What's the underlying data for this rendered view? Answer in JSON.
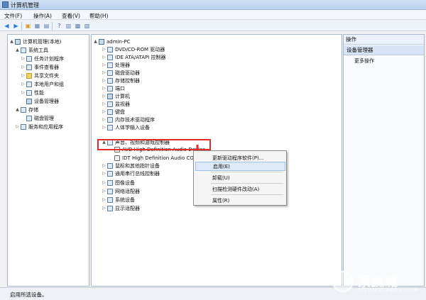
{
  "window": {
    "title": "计算机管理"
  },
  "menu": [
    "文件(F)",
    "操作(A)",
    "查看(V)",
    "帮助(H)"
  ],
  "left_tree": [
    {
      "label": "计算机管理(本地)",
      "indent": 0,
      "expander": "▲"
    },
    {
      "label": "系统工具",
      "indent": 1,
      "expander": "▲"
    },
    {
      "label": "任务计划程序",
      "indent": 2,
      "expander": "▷"
    },
    {
      "label": "事件查看器",
      "indent": 2,
      "expander": "▷"
    },
    {
      "label": "共享文件夹",
      "indent": 2,
      "expander": "▷"
    },
    {
      "label": "本地用户和组",
      "indent": 2,
      "expander": "▷"
    },
    {
      "label": "性能",
      "indent": 2,
      "expander": "▷"
    },
    {
      "label": "设备管理器",
      "indent": 2,
      "expander": ""
    },
    {
      "label": "存储",
      "indent": 1,
      "expander": "▲"
    },
    {
      "label": "磁盘管理",
      "indent": 2,
      "expander": ""
    },
    {
      "label": "服务和应用程序",
      "indent": 1,
      "expander": "▷"
    }
  ],
  "device_tree": [
    {
      "label": "admin-PC",
      "indent": 0,
      "expander": "▲"
    },
    {
      "label": "DVD/CD-ROM 驱动器",
      "indent": 1,
      "expander": "▷"
    },
    {
      "label": "IDE ATA/ATAPI 控制器",
      "indent": 1,
      "expander": "▷"
    },
    {
      "label": "处理器",
      "indent": 1,
      "expander": "▷"
    },
    {
      "label": "磁盘驱动器",
      "indent": 1,
      "expander": "▷"
    },
    {
      "label": "存储控制器",
      "indent": 1,
      "expander": "▷"
    },
    {
      "label": "端口",
      "indent": 1,
      "expander": "▷"
    },
    {
      "label": "计算机",
      "indent": 1,
      "expander": "▷"
    },
    {
      "label": "监视器",
      "indent": 1,
      "expander": "▷"
    },
    {
      "label": "键盘",
      "indent": 1,
      "expander": "▷"
    },
    {
      "label": "内存技术驱动程序",
      "indent": 1,
      "expander": "▷"
    },
    {
      "label": "人体学输入设备",
      "indent": 1,
      "expander": "▷"
    },
    {
      "label": "声音、视频和游戏控制器",
      "indent": 1,
      "expander": "▲"
    },
    {
      "label": "AVD High Definition Audio Device",
      "indent": 2,
      "expander": ""
    },
    {
      "label": "IDT High Definition Audio CO",
      "indent": 2,
      "expander": ""
    },
    {
      "label": "鼠标和其他指针设备",
      "indent": 1,
      "expander": "▷"
    },
    {
      "label": "通用串行总线控制器",
      "indent": 1,
      "expander": "▷"
    },
    {
      "label": "图像设备",
      "indent": 1,
      "expander": "▷"
    },
    {
      "label": "网络适配器",
      "indent": 1,
      "expander": "▷"
    },
    {
      "label": "系统设备",
      "indent": 1,
      "expander": "▷"
    },
    {
      "label": "显示适配器",
      "indent": 1,
      "expander": "▷"
    }
  ],
  "context_menu": {
    "items": [
      {
        "label": "更新驱动程序软件(P)...",
        "selected": false
      },
      {
        "label": "启用(E)",
        "selected": true
      },
      {
        "label": "卸载(U)",
        "selected": false
      },
      {
        "label": "扫描检测硬件改动(A)",
        "selected": false
      },
      {
        "label": "属性(R)",
        "selected": false
      }
    ]
  },
  "actions_pane": {
    "header": "操作",
    "section": "设备管理器",
    "item": "更多操作"
  },
  "status": {
    "text": "启用所选设备。"
  },
  "watermark": {
    "main": "系统城",
    "sub": "XITONGCHENG.COM"
  },
  "colors": {
    "highlight": "#e22b2b",
    "selection": "#dbe9f8",
    "background_green": "#7fd16a"
  }
}
